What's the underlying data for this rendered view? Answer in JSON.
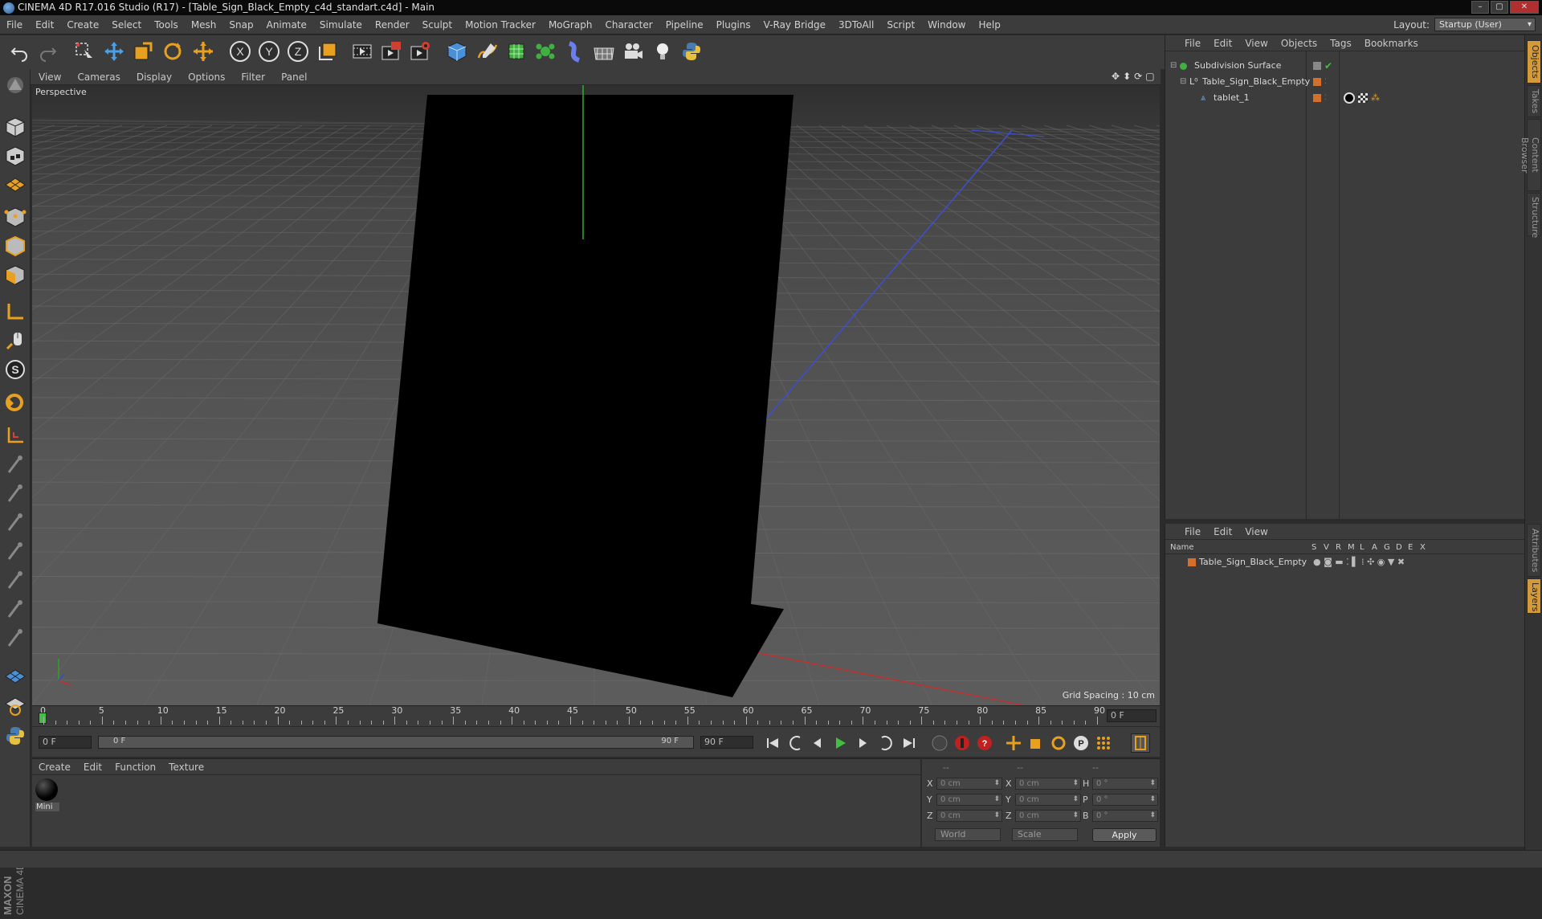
{
  "window": {
    "title": "CINEMA 4D R17.016 Studio (R17) - [Table_Sign_Black_Empty_c4d_standart.c4d] - Main",
    "minimize": "–",
    "maximize": "▢",
    "close": "✕"
  },
  "menubar": [
    "File",
    "Edit",
    "Create",
    "Select",
    "Tools",
    "Mesh",
    "Snap",
    "Animate",
    "Simulate",
    "Render",
    "Sculpt",
    "Motion Tracker",
    "MoGraph",
    "Character",
    "Pipeline",
    "Plugins",
    "V-Ray Bridge",
    "3DToAll",
    "Script",
    "Window",
    "Help"
  ],
  "layout": {
    "label": "Layout:",
    "value": "Startup (User)"
  },
  "toolbar": {
    "icons": [
      "undo-icon",
      "redo-icon",
      "live-select-icon",
      "move-icon",
      "scale-icon",
      "rotate-icon",
      "transform-icon",
      "x-axis-icon",
      "y-axis-icon",
      "z-axis-icon",
      "coordinate-system-icon",
      "render-view-icon",
      "render-picture-viewer-icon",
      "edit-render-settings-icon",
      "cube-icon",
      "spline-pen-icon",
      "subdivision-surface-icon",
      "cloner-icon",
      "deformer-icon",
      "floor-icon",
      "camera-icon",
      "light-icon",
      "python-icon"
    ],
    "axis_labels": [
      "X",
      "Y",
      "Z"
    ]
  },
  "viewport": {
    "menu": [
      "View",
      "Cameras",
      "Display",
      "Options",
      "Filter",
      "Panel"
    ],
    "camera_label": "Perspective",
    "grid_spacing": "Grid Spacing : 10 cm"
  },
  "timeline": {
    "ticks": [
      "0",
      "5",
      "10",
      "15",
      "20",
      "25",
      "30",
      "35",
      "40",
      "45",
      "50",
      "55",
      "60",
      "65",
      "70",
      "75",
      "80",
      "85",
      "90"
    ],
    "current_frame": "0 F"
  },
  "playbar": {
    "start_field": "0 F",
    "range_start": "0 F",
    "range_end": "90 F",
    "end_field": "90 F"
  },
  "material_panel": {
    "menu": [
      "Create",
      "Edit",
      "Function",
      "Texture"
    ],
    "materials": [
      {
        "name": "Mini"
      }
    ]
  },
  "coordinates": {
    "headers": [
      "--",
      "--",
      "--"
    ],
    "rows": [
      {
        "l1": "X",
        "v1": "0 cm",
        "l2": "X",
        "v2": "0 cm",
        "l3": "H",
        "v3": "0 °"
      },
      {
        "l1": "Y",
        "v1": "0 cm",
        "l2": "Y",
        "v2": "0 cm",
        "l3": "P",
        "v3": "0 °"
      },
      {
        "l1": "Z",
        "v1": "0 cm",
        "l2": "Z",
        "v2": "0 cm",
        "l3": "B",
        "v3": "0 °"
      }
    ],
    "mode": "World",
    "scale_mode": "Scale",
    "apply": "Apply"
  },
  "object_manager": {
    "menu": [
      "File",
      "Edit",
      "View",
      "Objects",
      "Tags",
      "Bookmarks"
    ],
    "objects": [
      {
        "name": "Subdivision Surface"
      },
      {
        "name": "Table_Sign_Black_Empty"
      },
      {
        "name": "tablet_1"
      }
    ]
  },
  "layer_manager": {
    "menu": [
      "File",
      "Edit",
      "View"
    ],
    "columns": [
      "Name",
      "S",
      "V",
      "R",
      "M",
      "L",
      "A",
      "G",
      "D",
      "E",
      "X"
    ],
    "layers": [
      {
        "name": "Table_Sign_Black_Empty",
        "color": "#d4702a"
      }
    ]
  },
  "right_tabs": [
    "Objects",
    "Takes",
    "Content Browser",
    "Structure",
    "Attributes",
    "Layers"
  ],
  "brand": {
    "text1": "MAXON",
    "text2": "CINEMA 4D"
  },
  "colors": {
    "accent": "#d49a3a",
    "axis_x": "#c03030",
    "axis_y": "#30a030",
    "axis_z": "#3050c0",
    "object_orange": "#d4702a"
  }
}
